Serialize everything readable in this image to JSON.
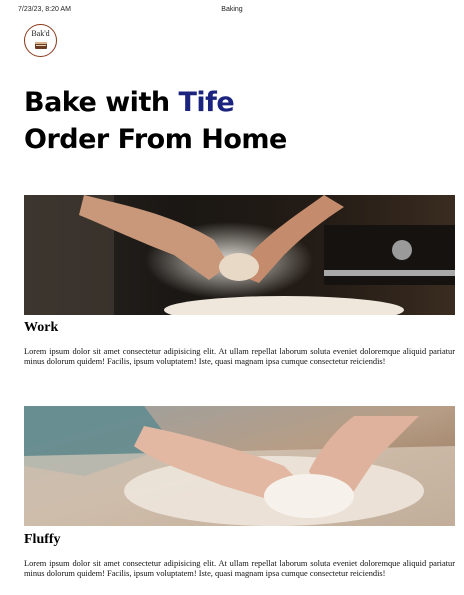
{
  "print_header": {
    "date": "7/23/23, 8:20 AM",
    "title": "Baking"
  },
  "logo": {
    "text": "Bak'd"
  },
  "hero": {
    "line1_prefix": "Bake with ",
    "line1_accent": "Tife",
    "line2": "Order From Home"
  },
  "colors": {
    "accent": "#1a237e",
    "logo_border": "#8b3a1c"
  },
  "cards": [
    {
      "image_icon": "hands-flour-dough-photo",
      "title": "Work",
      "text": "Lorem ipsum dolor sit amet consectetur adipisicing elit. At ullam repellat laborum soluta eveniet doloremque aliquid pariatur minus dolorum quidem! Facilis, ipsum voluptatem! Iste, quasi magnam ipsa cumque consectetur reiciendis!"
    },
    {
      "image_icon": "hands-kneading-dough-photo",
      "title": "Fluffy",
      "text": "Lorem ipsum dolor sit amet consectetur adipisicing elit. At ullam repellat laborum soluta eveniet doloremque aliquid pariatur minus dolorum quidem! Facilis, ipsum voluptatem! Iste, quasi magnam ipsa cumque consectetur reiciendis!"
    }
  ]
}
